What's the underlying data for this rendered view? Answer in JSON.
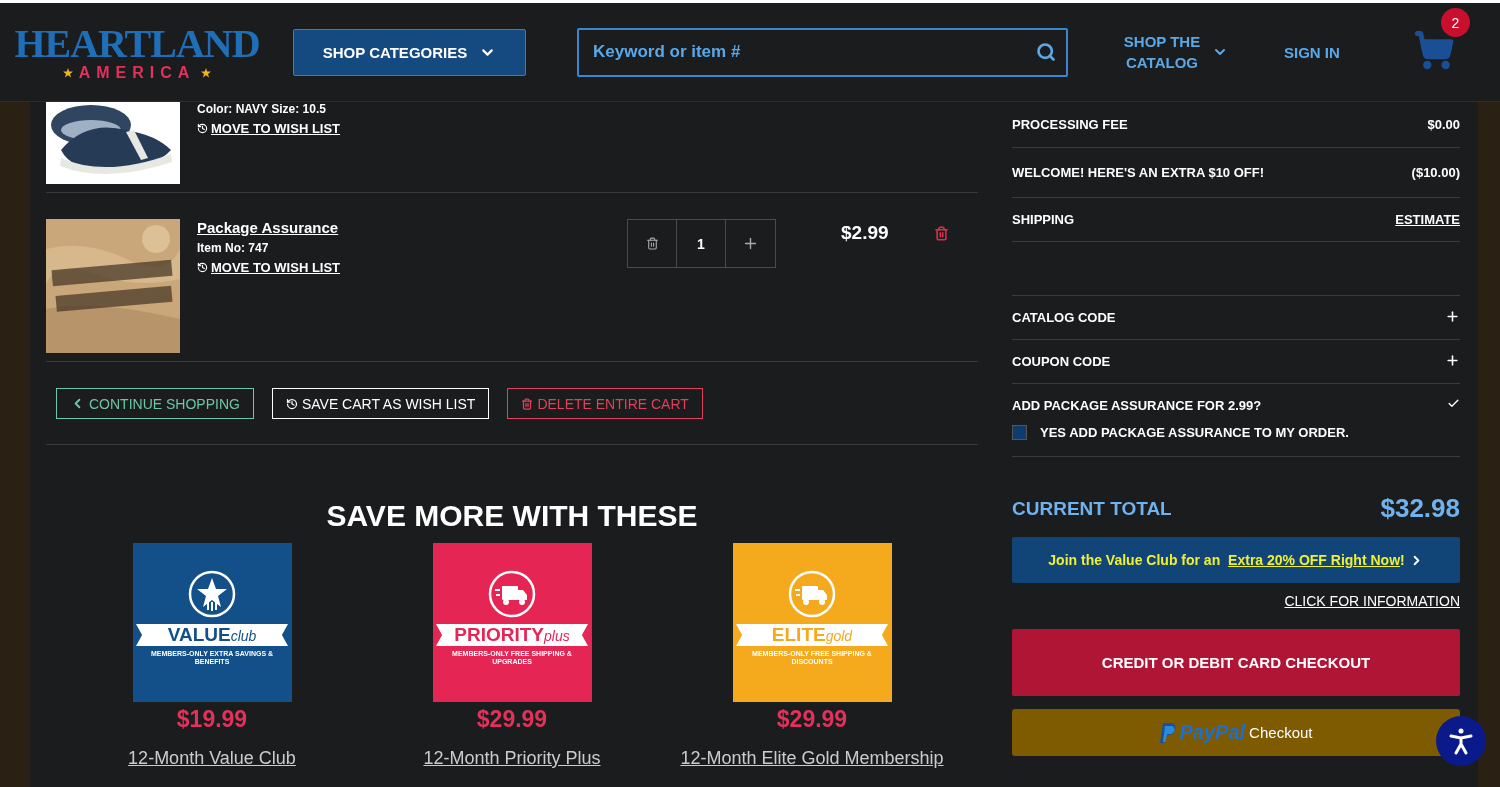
{
  "header": {
    "logo": {
      "top": "HEARTLAND",
      "bottom": "AMERICA"
    },
    "categories_button": "SHOP CATEGORIES",
    "search": {
      "placeholder": "Keyword or item #"
    },
    "catalog_link": "SHOP THE CATALOG",
    "sign_in": "SIGN IN",
    "cart_count": "2"
  },
  "cart_items": [
    {
      "kind": "partial",
      "details": "Color: NAVY Size: 10.5",
      "wish_link": "MOVE TO WISH LIST"
    },
    {
      "kind": "full",
      "name": "Package Assurance",
      "item_no": "Item No: 747",
      "wish_link": "MOVE TO WISH LIST",
      "quantity": "1",
      "price": "$2.99"
    }
  ],
  "cart_actions": [
    {
      "kind": "continue",
      "label": "CONTINUE SHOPPING"
    },
    {
      "kind": "save",
      "label": "SAVE CART AS WISH LIST"
    },
    {
      "kind": "delete",
      "label": "DELETE ENTIRE CART"
    }
  ],
  "promo": {
    "heading": "SAVE MORE WITH THESE",
    "cards": [
      {
        "color": "#135089",
        "brand": "VALUE",
        "brand_sub": "club",
        "tagline": "MEMBERS-ONLY EXTRA SAVINGS & BENEFITS",
        "price": "$19.99",
        "link": "12-Month Value Club"
      },
      {
        "color": "#e52554",
        "brand": "PRIORITY",
        "brand_sub": "plus",
        "tagline": "MEMBERS-ONLY FREE SHIPPING & UPGRADES",
        "price": "$29.99",
        "link": "12-Month Priority Plus"
      },
      {
        "color": "#f5a91d",
        "brand": "ELITE",
        "brand_sub": "gold",
        "tagline": "MEMBERS-ONLY FREE SHIPPING & DISCOUNTS",
        "price": "$29.99",
        "link": "12-Month Elite Gold Membership"
      }
    ]
  },
  "summary": {
    "rows": [
      {
        "kind": "amount",
        "label": "PROCESSING FEE",
        "value": "$0.00"
      },
      {
        "kind": "amount",
        "label": "WELCOME! HERE'S AN EXTRA $10 OFF!",
        "value": "($10.00)"
      },
      {
        "kind": "link",
        "label": "SHIPPING",
        "value": "ESTIMATE"
      }
    ],
    "codes": [
      {
        "label": "CATALOG CODE",
        "expanded": false
      },
      {
        "label": "COUPON CODE",
        "expanded": false
      }
    ],
    "assurance": {
      "question": "ADD PACKAGE ASSURANCE FOR 2.99?",
      "expanded": true,
      "option": "YES ADD PACKAGE ASSURANCE TO MY ORDER.",
      "checked": false
    },
    "total": {
      "label": "CURRENT TOTAL",
      "value": "$32.98"
    },
    "club_banner": {
      "text": "Join the Value Club for an ",
      "link": "Extra 20% OFF Right Now",
      "suffix": "!"
    },
    "info_link": "CLICK FOR INFORMATION",
    "card_checkout": "CREDIT OR DEBIT CARD CHECKOUT",
    "paypal": {
      "logo": "PayPal",
      "label": "Checkout"
    }
  }
}
